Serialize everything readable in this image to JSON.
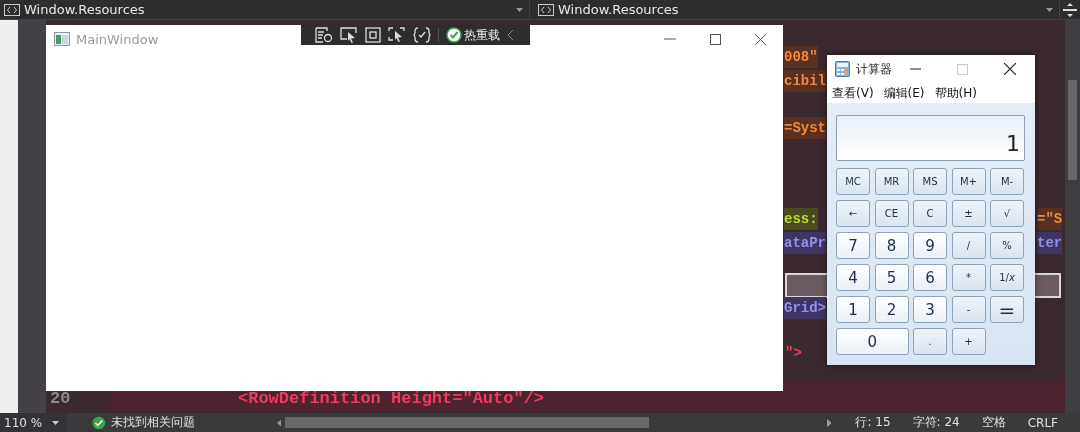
{
  "editor_tabs": [
    {
      "title": "Window.Resources"
    },
    {
      "title": "Window.Resources"
    }
  ],
  "code_fragments": [
    {
      "text": "008\"",
      "kind": "value"
    },
    {
      "text": "cibil",
      "kind": "value"
    },
    {
      "text": "=Syst",
      "kind": "value"
    },
    {
      "text": "ess:",
      "kind": "prefix"
    },
    {
      "text": "=\"S",
      "kind": "value"
    },
    {
      "text": "ataPr",
      "kind": "binding"
    },
    {
      "text": "ter",
      "kind": "binding"
    },
    {
      "text": "Grid>",
      "kind": "binding"
    },
    {
      "text": "\">",
      "kind": "tag"
    },
    {
      "text": "<RowDefinition Height=\"Auto\"/>",
      "kind": "tag"
    }
  ],
  "line_number": "20",
  "main_window": {
    "title": "MainWindow",
    "hot_reload": "热重载"
  },
  "calculator": {
    "title": "计算器",
    "menu": [
      "查看(V)",
      "编辑(E)",
      "帮助(H)"
    ],
    "display": "1",
    "buttons": [
      {
        "label": "MC",
        "kind": "memory"
      },
      {
        "label": "MR",
        "kind": "memory"
      },
      {
        "label": "MS",
        "kind": "memory"
      },
      {
        "label": "M+",
        "kind": "memory"
      },
      {
        "label": "M-",
        "kind": "memory"
      },
      {
        "label": "←",
        "kind": "op"
      },
      {
        "label": "CE",
        "kind": "op"
      },
      {
        "label": "C",
        "kind": "op"
      },
      {
        "label": "±",
        "kind": "op"
      },
      {
        "label": "√",
        "kind": "op"
      },
      {
        "label": "7",
        "kind": "digit"
      },
      {
        "label": "8",
        "kind": "digit"
      },
      {
        "label": "9",
        "kind": "digit"
      },
      {
        "label": "/",
        "kind": "op"
      },
      {
        "label": "%",
        "kind": "op"
      },
      {
        "label": "4",
        "kind": "digit"
      },
      {
        "label": "5",
        "kind": "digit"
      },
      {
        "label": "6",
        "kind": "digit"
      },
      {
        "label": "*",
        "kind": "op"
      },
      {
        "label": "1/*x*",
        "kind": "op"
      },
      {
        "label": "1",
        "kind": "digit"
      },
      {
        "label": "2",
        "kind": "digit"
      },
      {
        "label": "3",
        "kind": "digit"
      },
      {
        "label": "-",
        "kind": "op"
      },
      {
        "label": "=",
        "kind": "tall"
      },
      {
        "label": "0",
        "kind": "wide"
      },
      {
        "label": ".",
        "kind": "op"
      },
      {
        "label": "+",
        "kind": "op"
      }
    ]
  },
  "status_bar": {
    "zoom": "110 %",
    "issues": "未找到相关问题",
    "line": "行: 15",
    "column": "字符: 24",
    "indent": "空格",
    "line_ending": "CRLF"
  }
}
